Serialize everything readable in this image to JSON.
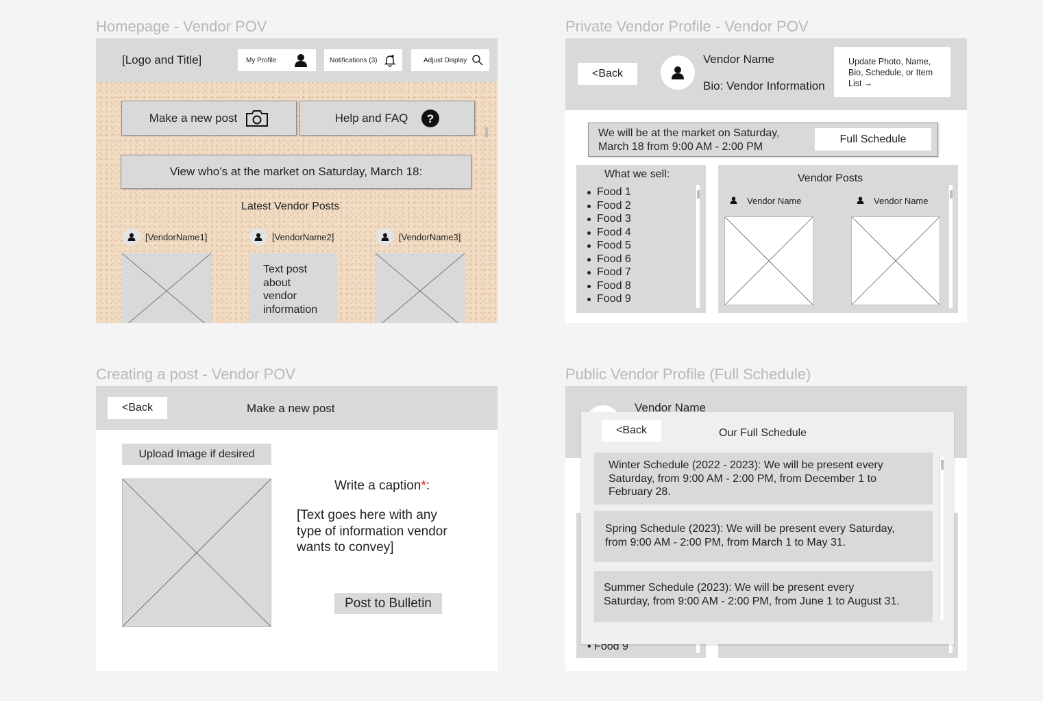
{
  "frames": {
    "homepage": {
      "title": "Homepage - Vendor POV",
      "logo_title": "[Logo and Title]",
      "my_profile": "My Profile",
      "notifications": "Notifications (3)",
      "adjust_display": "Adjust Display",
      "make_post": "Make a new post",
      "help_faq": "Help and FAQ",
      "view_market": "View who’s at the market on Saturday, March 18:",
      "latest_posts": "Latest Vendor Posts",
      "vendors": [
        "[VendorName1]",
        "[VendorName2]",
        "[VendorName3]"
      ],
      "text_post_lines": [
        "Text post",
        "about",
        "vendor",
        "information"
      ]
    },
    "private_profile": {
      "title": "Private Vendor Profile - Vendor POV",
      "back": "<Back",
      "vendor_name": "Vendor Name",
      "bio": "Bio: Vendor Information",
      "update_lines": [
        "Update Photo, Name,",
        "Bio, Schedule, or Item",
        "List →"
      ],
      "market_line1": "We will be at the market on Saturday,",
      "market_line2": "March 18 from 9:00 AM - 2:00 PM",
      "full_schedule": "Full Schedule",
      "what_we_sell": "What we sell:",
      "foods": [
        "Food 1",
        "Food 2",
        "Food 3",
        "Food 4",
        "Food 5",
        "Food 6",
        "Food 7",
        "Food 8",
        "Food 9"
      ],
      "vendor_posts": "Vendor Posts",
      "post_vendor_names": [
        "Vendor Name",
        "Vendor Name"
      ]
    },
    "creating_post": {
      "title": "Creating a post - Vendor POV",
      "back": "<Back",
      "header": "Make a new post",
      "upload": "Upload Image if desired",
      "caption_label": "Write a caption",
      "caption_required": "*",
      "caption_colon": ":",
      "caption_text_lines": [
        "[Text goes here with any",
        "type of information vendor",
        "wants to convey]"
      ],
      "post_button": "Post to Bulletin"
    },
    "public_profile": {
      "title": "Public Vendor Profile (Full Schedule)",
      "vendor_name": "Vendor Name",
      "back": "<Back",
      "modal_title": "Our Full Schedule",
      "schedules": [
        {
          "lines": [
            "Winter Schedule (2022 - 2023): We will be present every",
            "Saturday, from 9:00 AM - 2:00 PM, from December 1 to",
            "February 28."
          ]
        },
        {
          "lines": [
            "Spring Schedule (2023): We will be present every Saturday,",
            "from 9:00 AM - 2:00 PM, from March 1 to May 31."
          ]
        },
        {
          "lines": [
            "Summer Schedule (2023): We will be present every",
            "Saturday, from 9:00 AM - 2:00 PM, from June 1 to August 31."
          ]
        }
      ],
      "food_peek": "Food 9"
    }
  },
  "colors": {
    "background": "#f4f4f4",
    "panel_gray": "#d9d9d9",
    "required": "#e02020",
    "title_gray": "#b8b8b8"
  },
  "icons": [
    "person-icon",
    "bell-icon",
    "search-icon",
    "camera-icon",
    "question-icon"
  ]
}
